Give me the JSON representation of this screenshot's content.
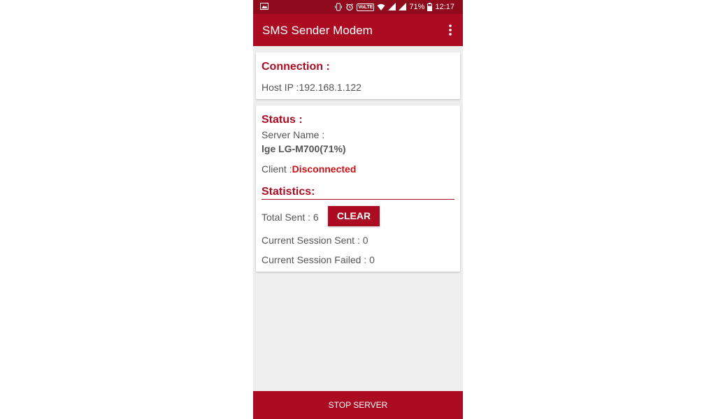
{
  "status_bar": {
    "battery": "71%",
    "time": "12:17",
    "volte": "VoLTE",
    "icons": [
      "image-icon",
      "vibrate-icon",
      "alarm-icon",
      "volte-icon",
      "wifi-icon",
      "signal-icon",
      "signal-icon",
      "battery-icon"
    ]
  },
  "appbar": {
    "title": "SMS Sender Modem",
    "menu_icon": "more-vert-icon"
  },
  "connection": {
    "heading": "Connection :",
    "host_ip_label": "Host IP :",
    "host_ip_value": "192.168.1.122"
  },
  "status": {
    "heading": "Status :",
    "server_name_label": "Server Name :",
    "server_name_value": "lge LG-M700(71%)",
    "client_label": "Client :",
    "client_value": "Disconnected"
  },
  "statistics": {
    "heading": "Statistics:",
    "total_sent": "Total Sent : 6",
    "clear_label": "CLEAR",
    "current_session_sent": "Current Session Sent : 0",
    "current_session_failed": "Current Session Failed : 0"
  },
  "footer": {
    "stop_label": "STOP SERVER"
  },
  "colors": {
    "status_bar": "#8e0a1c",
    "accent": "#ac0c22",
    "error": "#cc1016",
    "background": "#eeeeee"
  }
}
